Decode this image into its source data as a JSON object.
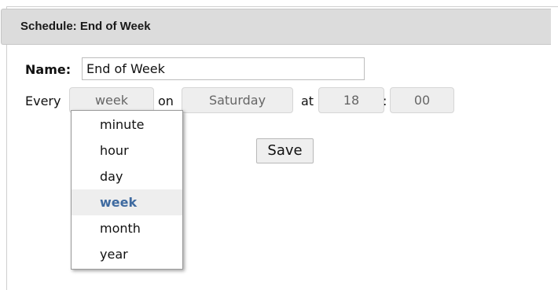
{
  "header": {
    "title": "Schedule: End of Week"
  },
  "form": {
    "name_label": "Name:",
    "name_value": "End of Week",
    "every_label": "Every",
    "frequency_value": "week",
    "on_label": "on",
    "day_value": "Saturday",
    "at_label": "at",
    "hour_value": "18",
    "time_separator": ":",
    "minute_value": "00",
    "save_label": "Save"
  },
  "frequency_dropdown": {
    "options": [
      "minute",
      "hour",
      "day",
      "week",
      "month",
      "year"
    ],
    "selected": "week"
  },
  "colors": {
    "header_bg": "#dcdcdc",
    "select_bg": "#eeeeee",
    "selected_text": "#3e6aa0"
  }
}
